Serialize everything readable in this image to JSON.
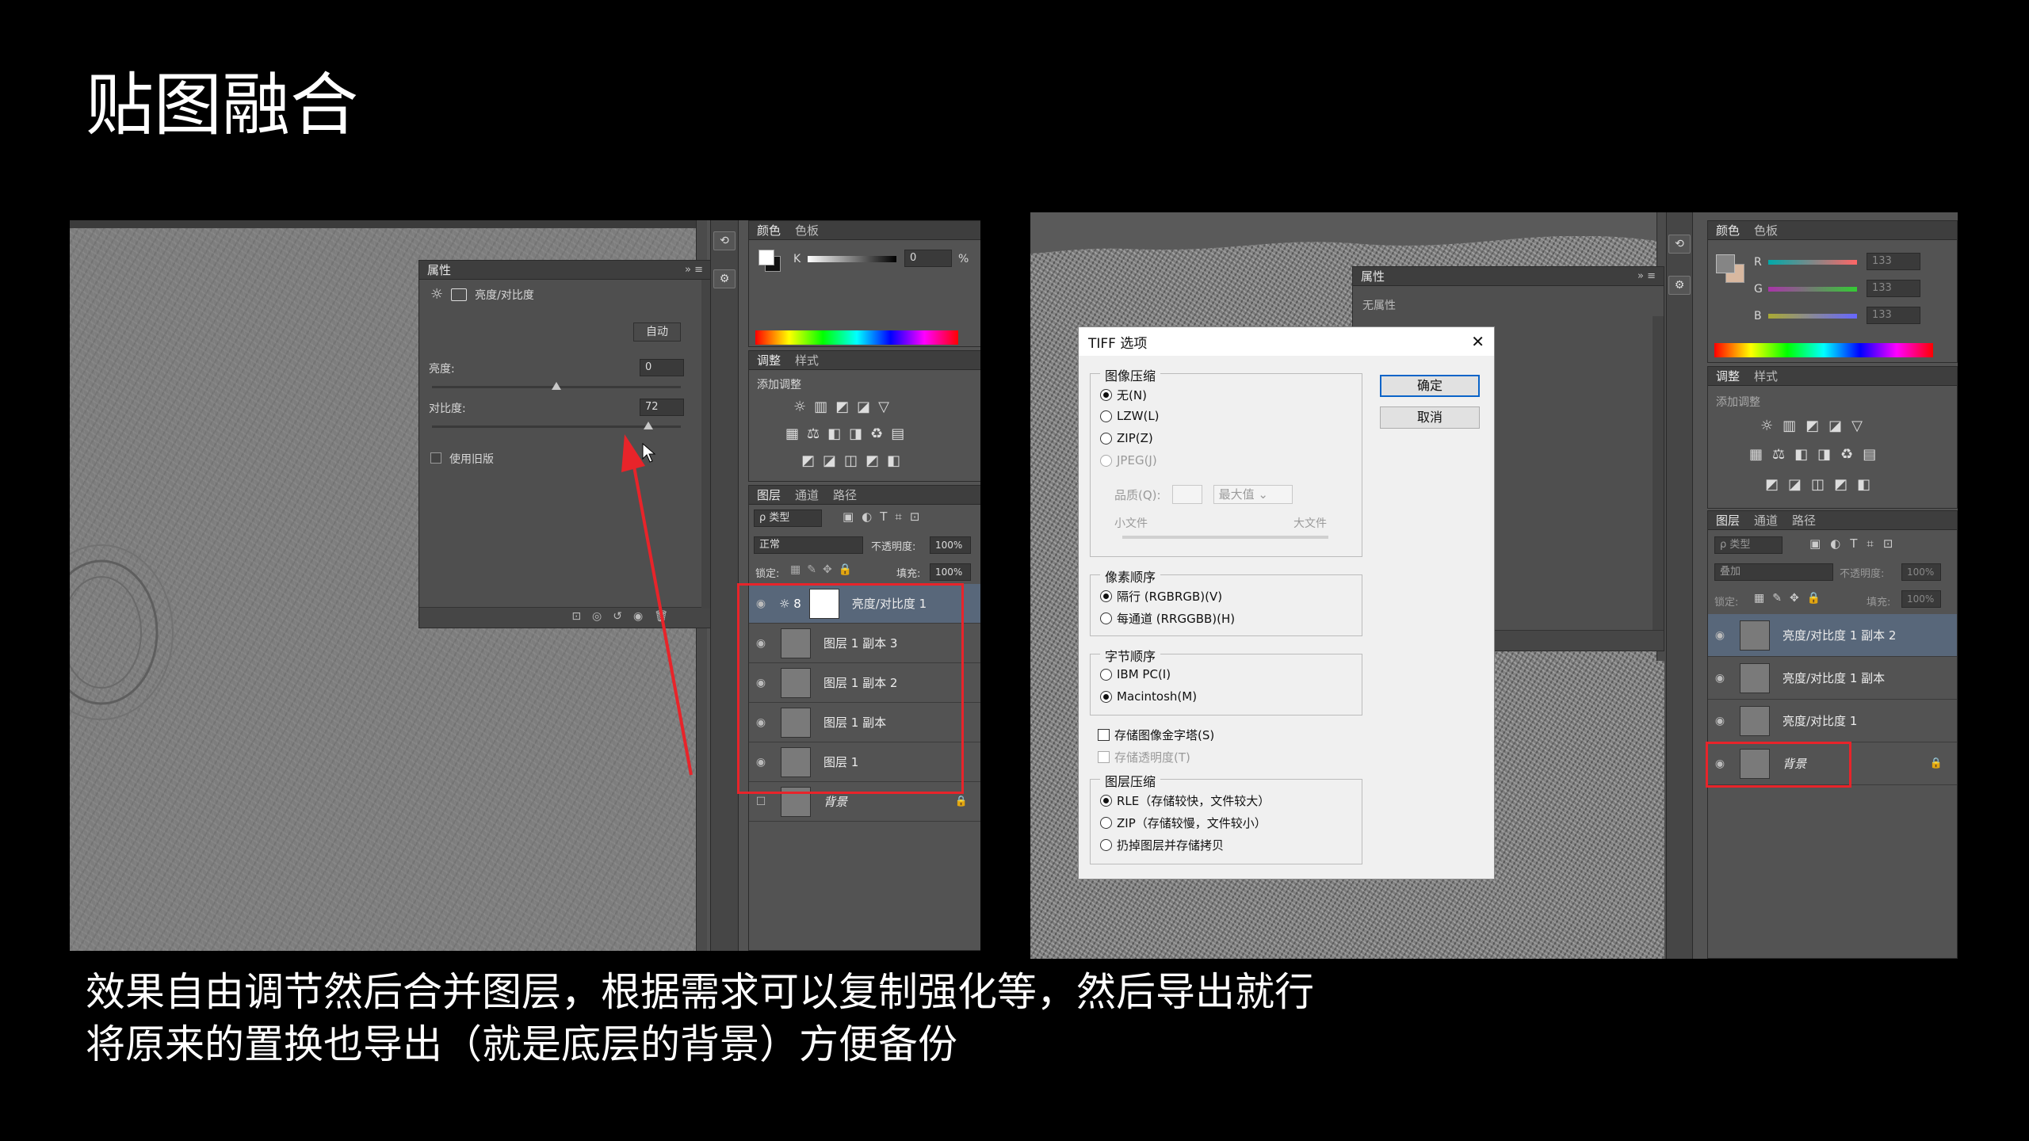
{
  "slide": {
    "title": "贴图融合",
    "caption_line1": "效果自由调节然后合并图层，根据需求可以复制强化等，然后导出就行",
    "caption_line2": "将原来的置换也导出（就是底层的背景）方便备份"
  },
  "left": {
    "properties": {
      "header": "属性",
      "adjustment_name": "亮度/对比度",
      "auto_button": "自动",
      "brightness_label": "亮度:",
      "brightness_value": "0",
      "brightness_level": 0.5,
      "contrast_label": "对比度:",
      "contrast_value": "72",
      "contrast_level": 0.87,
      "legacy_label": "使用旧版"
    },
    "color_panel": {
      "tab_color": "颜色",
      "tab_swatches": "色板",
      "k_label": "K",
      "k_value": "0",
      "percent": "%"
    },
    "adjust_panel": {
      "tab_adjust": "调整",
      "tab_styles": "样式",
      "add_label": "添加调整"
    },
    "layers_panel": {
      "tab_layers": "图层",
      "tab_channels": "通道",
      "tab_paths": "路径",
      "filter": "ρ 类型",
      "blend": "正常",
      "opacity_label": "不透明度:",
      "opacity_value": "100%",
      "lock_label": "锁定:",
      "fill_label": "填充:",
      "fill_value": "100%",
      "layers": [
        {
          "name": "亮度/对比度 1",
          "type": "adjust",
          "selected": true
        },
        {
          "name": "图层 1 副本 3",
          "type": "pixel"
        },
        {
          "name": "图层 1 副本 2",
          "type": "pixel"
        },
        {
          "name": "图层 1 副本",
          "type": "pixel"
        },
        {
          "name": "图层 1",
          "type": "pixel"
        },
        {
          "name": "背景",
          "type": "background"
        }
      ]
    }
  },
  "right": {
    "properties": {
      "header": "属性",
      "no_props": "无属性"
    },
    "color_panel": {
      "tab_color": "颜色",
      "tab_swatches": "色板",
      "r": "R",
      "g": "G",
      "b": "B",
      "r_value": "133",
      "g_value": "133",
      "b_value": "133"
    },
    "adjust_panel": {
      "tab_adjust": "调整",
      "tab_styles": "样式",
      "add_label": "添加调整"
    },
    "layers_panel": {
      "tab_layers": "图层",
      "tab_channels": "通道",
      "tab_paths": "路径",
      "filter": "ρ 类型",
      "blend": "叠加",
      "opacity_label": "不透明度:",
      "opacity_value": "100%",
      "lock_label": "锁定:",
      "fill_label": "填充:",
      "fill_value": "100%",
      "layers": [
        {
          "name": "亮度/对比度 1 副本 2",
          "selected": true
        },
        {
          "name": "亮度/对比度 1 副本"
        },
        {
          "name": "亮度/对比度 1"
        },
        {
          "name": "背景"
        }
      ]
    },
    "tiff_dialog": {
      "title": "TIFF 选项",
      "ok": "确定",
      "cancel": "取消",
      "compression_label": "图像压缩",
      "comp_none": "无(N)",
      "comp_lzw": "LZW(L)",
      "comp_zip": "ZIP(Z)",
      "comp_jpeg": "JPEG(J)",
      "quality_label": "品质(Q):",
      "quality_value": "最大值",
      "small_file": "小文件",
      "large_file": "大文件",
      "pixel_order_label": "像素顺序",
      "interleaved": "隔行 (RGBRGB)(V)",
      "per_channel": "每通道 (RRGGBB)(H)",
      "byte_order_label": "字节顺序",
      "ibm_pc": "IBM PC(I)",
      "macintosh": "Macintosh(M)",
      "save_pyramid": "存储图像金字塔(S)",
      "save_transparency": "存储透明度(T)",
      "layer_compression_label": "图层压缩",
      "rle": "RLE（存储较快，文件较大）",
      "zip_layers": "ZIP（存储较慢，文件较小）",
      "discard_layers": "扔掉图层并存储拷贝"
    }
  }
}
